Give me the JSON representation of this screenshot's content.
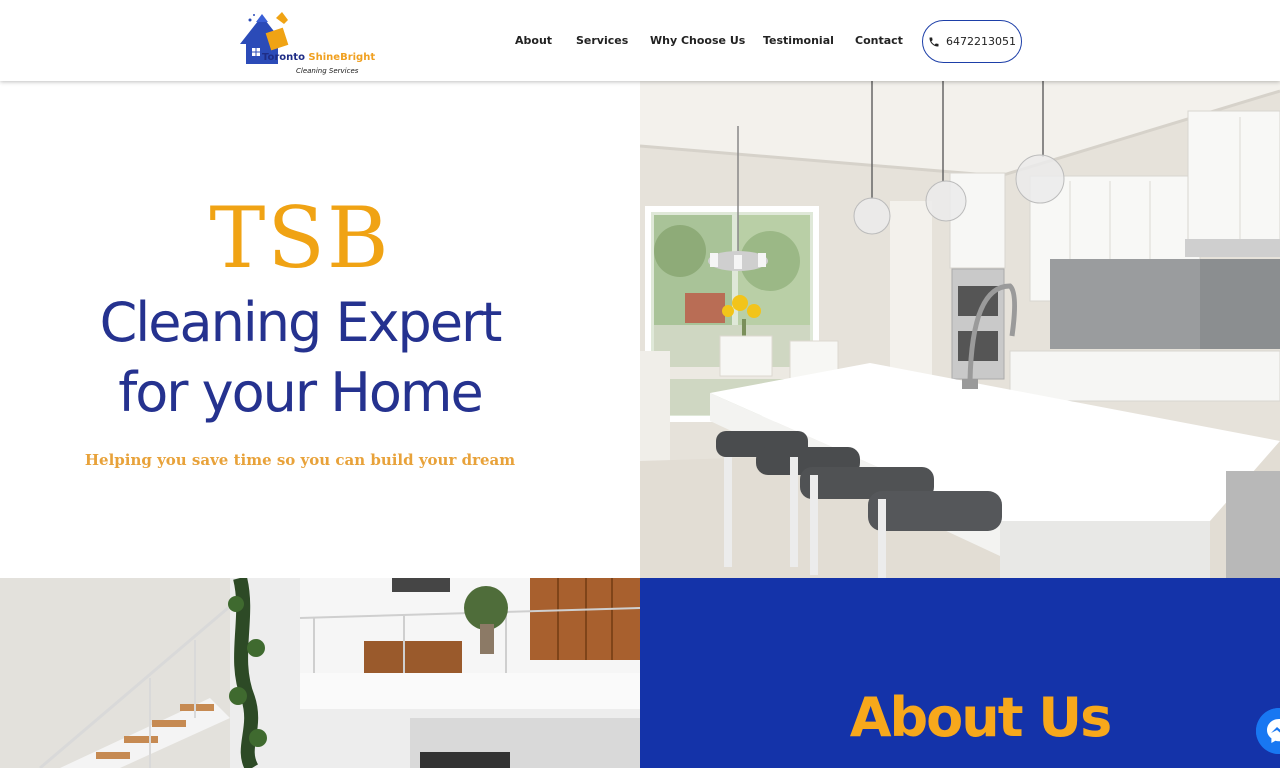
{
  "header": {
    "logo": {
      "name": "Toronto ShineBright",
      "word1": "Toronto ",
      "word2": "ShineBright",
      "sub": "Cleaning Services"
    },
    "nav": [
      {
        "label": "About"
      },
      {
        "label": "Services"
      },
      {
        "label": "Why Choose Us"
      },
      {
        "label": "Testimonial"
      },
      {
        "label": "Contact"
      }
    ],
    "phone": "6472213051"
  },
  "hero": {
    "brand": "TSB",
    "title_line1": "Cleaning Expert",
    "title_line2": "for your Home",
    "subtitle": "Helping you save time so you can build your dream"
  },
  "about": {
    "title": "About Us"
  },
  "colors": {
    "primary": "#1433a9",
    "accent": "#f0a314",
    "title": "#25328f"
  },
  "icons": {
    "phone": "phone-icon",
    "messenger": "messenger-icon"
  }
}
